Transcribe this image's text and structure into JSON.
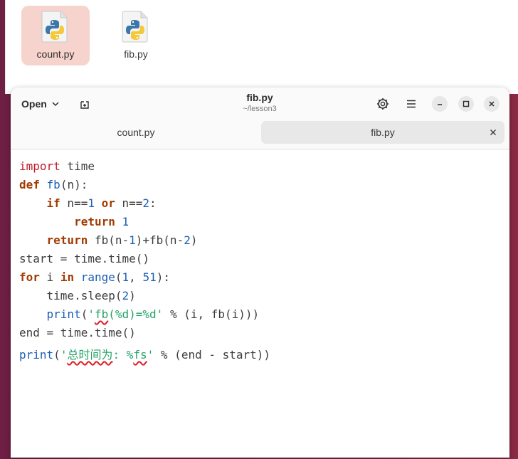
{
  "files": [
    {
      "name": "count.py",
      "selected": true
    },
    {
      "name": "fib.py",
      "selected": false
    }
  ],
  "header": {
    "open_label": "Open",
    "title": "fib.py",
    "subtitle": "~/lesson3"
  },
  "tabs": [
    {
      "label": "count.py",
      "active": false
    },
    {
      "label": "fib.py",
      "active": true
    }
  ],
  "code": {
    "l1": {
      "k": "import",
      "r": " time"
    },
    "l2": {
      "k": "def",
      "sp": " ",
      "fn": "fb",
      "r": "(n):"
    },
    "l3": {
      "ind": "    ",
      "k": "if",
      "a": " n==",
      "n1": "1",
      "k2": " or",
      "b": " n==",
      "n2": "2",
      "c": ":"
    },
    "l4": {
      "ind": "        ",
      "k": "return",
      "sp": " ",
      "n1": "1"
    },
    "l5": {
      "ind": "    ",
      "k": "return",
      "a": " fb(n-",
      "n1": "1",
      "b": ")+fb(n-",
      "n2": "2",
      "c": ")"
    },
    "l6": {
      "t": "start = time.time()"
    },
    "l7": {
      "k": "for",
      "a": " i ",
      "k2": "in",
      "sp": " ",
      "b": "range",
      "c": "(",
      "n1": "1",
      "d": ", ",
      "n2": "51",
      "e": "):"
    },
    "l8": {
      "ind": "    ",
      "a": "time.sleep(",
      "n1": "2",
      "b": ")"
    },
    "l9": {
      "ind": "    ",
      "b": "print",
      "c": "(",
      "s1": "'",
      "s2": "fb",
      "s3": "(%d)=%d'",
      "d": " % (i, fb(i)))"
    },
    "l10": {
      "t": "end = time.time()"
    },
    "l11": {
      "b": "print",
      "c": "(",
      "s1": "'",
      "s2": "总时间为",
      "s3": ": %",
      "s4": "fs",
      "s5": "'",
      "d": " % (end - start))"
    }
  },
  "colors": {
    "keyword": "#c01c28",
    "keyword_bold": "#a23a02",
    "function": "#1a5fb4",
    "number": "#1a5fb4",
    "string": "#26a269",
    "spellcheck": "#e01b24",
    "selected_file_bg": "#f6d3cc",
    "desktop_bg": "#7a2446"
  },
  "icons": {
    "file": "python-file-icon",
    "open_dropdown": "chevron-down-icon",
    "new_tab": "new-tab-icon",
    "settings": "gear-icon",
    "menu": "hamburger-menu-icon",
    "minimize": "minimize-icon",
    "maximize": "maximize-icon",
    "close": "close-icon",
    "tab_close": "tab-close-icon"
  }
}
